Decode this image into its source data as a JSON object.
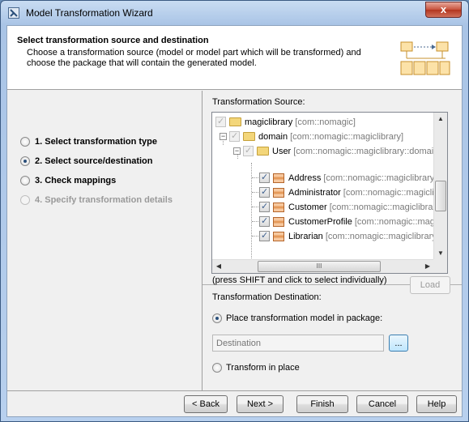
{
  "window": {
    "title": "Model Transformation Wizard",
    "close_label": "x"
  },
  "header": {
    "title": "Select transformation source and destination",
    "description": "Choose a transformation source (model or model part which will be transformed) and choose the package that will contain the generated model."
  },
  "steps": [
    {
      "label": "1. Select transformation type",
      "state": "unchecked"
    },
    {
      "label": "2. Select source/destination",
      "state": "checked"
    },
    {
      "label": "3. Check mappings",
      "state": "unchecked"
    },
    {
      "label": "4. Specify transformation details",
      "state": "disabled"
    }
  ],
  "source": {
    "label": "Transformation Source:",
    "tree": [
      {
        "name": "magiclibrary",
        "qualifier": "[com::nomagic]",
        "icon": "folder-icon",
        "checked": true,
        "disabled": true
      },
      {
        "name": "domain",
        "qualifier": "[com::nomagic::magiclibrary]",
        "icon": "folder-icon",
        "checked": true,
        "disabled": true
      },
      {
        "name": "User",
        "qualifier": "[com::nomagic::magiclibrary::domain]",
        "icon": "folder-icon",
        "checked": true,
        "disabled": true
      },
      {
        "name": "Address",
        "qualifier": "[com::nomagic::magiclibrary::dc",
        "icon": "class-icon",
        "checked": true,
        "disabled": false
      },
      {
        "name": "Administrator",
        "qualifier": "[com::nomagic::magiclibrar",
        "icon": "class-icon",
        "checked": true,
        "disabled": false
      },
      {
        "name": "Customer",
        "qualifier": "[com::nomagic::magiclibrary::c",
        "icon": "class-icon",
        "checked": true,
        "disabled": false
      },
      {
        "name": "CustomerProfile",
        "qualifier": "[com::nomagic::magiclib",
        "icon": "class-icon",
        "checked": true,
        "disabled": false
      },
      {
        "name": "Librarian",
        "qualifier": "[com::nomagic::magiclibrary::d",
        "icon": "class-icon",
        "checked": true,
        "disabled": false
      }
    ],
    "scroll_grip": "III",
    "hint": "(press SHIFT and click to select individually)",
    "load_label": "Load"
  },
  "destination": {
    "label": "Transformation Destination:",
    "place_option": "Place transformation model in package:",
    "destination_placeholder": "Destination",
    "browse_label": "...",
    "in_place_option": "Transform in place"
  },
  "footer": {
    "back": "< Back",
    "next": "Next >",
    "finish": "Finish",
    "cancel": "Cancel",
    "help": "Help"
  },
  "colors": {
    "titlebar": "#b8d0ee",
    "accent": "#2a4f7a",
    "close": "#c7523c"
  }
}
